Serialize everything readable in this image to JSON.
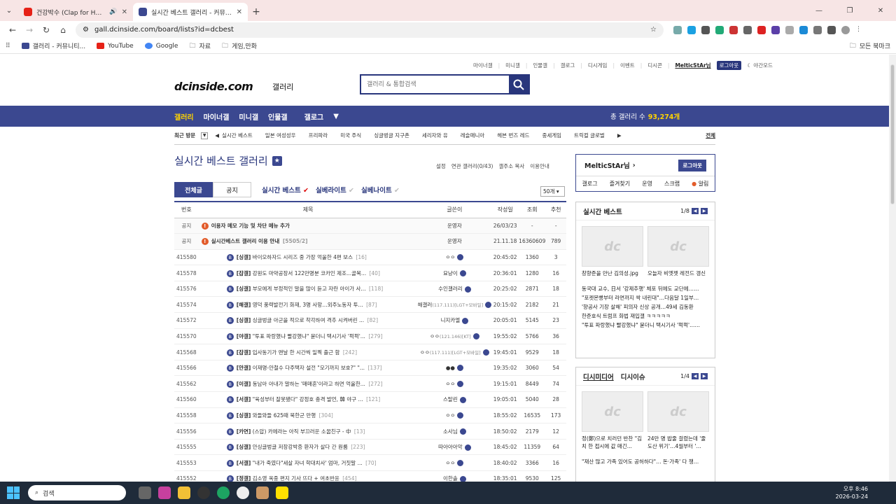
{
  "browser": {
    "tabs": [
      {
        "label": "건강박수 (Clap for Health)"
      },
      {
        "label": "실시간 베스트 갤러리 - 커뮤니티"
      }
    ],
    "url": "gall.dcinside.com/board/lists?id=dcbest",
    "bookmarks": [
      "갤러리 - 커뮤니티...",
      "YouTube",
      "Google",
      "자료",
      "게임,만화"
    ],
    "bookmarks_right": "모든 북마크"
  },
  "top_links": {
    "items": [
      "마이너갤",
      "미니갤",
      "인물갤",
      "갤로그",
      "디시게임",
      "이벤트",
      "디시콘"
    ],
    "user": "MelticStAr님",
    "logout": "로그아웃",
    "night": "야간모드"
  },
  "header": {
    "logo": "dcinside.com",
    "logo_sub": "갤러리",
    "search_placeholder": "갤러리 & 통합검색"
  },
  "gnb": {
    "items": [
      "갤러리",
      "마이너갤",
      "미니갤",
      "인물갤",
      "갤로그"
    ],
    "count_label": "총 갤러리 수",
    "count": "93,274개"
  },
  "recent": {
    "label": "최근 방문",
    "items": [
      "실시간 베스트",
      "일본 여성성우",
      "프리파라",
      "미국 주식",
      "싱글벙글 지구촌",
      "세리자와 유",
      "레슬매니아",
      "헤븐 번즈 레드",
      "중세게임",
      "트릭컬 글로벌"
    ],
    "all": "전체"
  },
  "gallery": {
    "title": "실시간 베스트 갤러리",
    "options": [
      "설정",
      "연관 갤러리(0/43)",
      "갤주소 복사",
      "이용안내"
    ]
  },
  "list_tabs": {
    "all": "전체글",
    "notice": "공지",
    "best_links": [
      "실시간 베스트",
      "실베라이트",
      "실베나이트"
    ],
    "per_page": "50개"
  },
  "table": {
    "headers": [
      "번호",
      "제목",
      "글쓴이",
      "작성일",
      "조회",
      "추천"
    ],
    "rows": [
      {
        "num": "공지",
        "title": "이용자 메모 기능 및 차단 메뉴 추가",
        "cmt": "",
        "writer": "운영자",
        "date": "26/03/23",
        "views": "-",
        "rec": "-",
        "notice": true
      },
      {
        "num": "공지",
        "title": "실시간베스트 갤러리 이용 안내",
        "cmt": "[5505/2]",
        "writer": "운영자",
        "date": "21.11.18",
        "views": "16360609",
        "rec": "789",
        "notice": true
      },
      {
        "num": "415580",
        "tag": "[싱갤]",
        "title": "바이오하자드 시리즈 중 가장 억울한 4편 보스",
        "cmt": "[16]",
        "writer": "ㅇㅇ",
        "date": "20:45:02",
        "views": "1360",
        "rec": "3"
      },
      {
        "num": "415578",
        "tag": "[잡갤]",
        "title": "강원도 마약공장서 122만명분 코카인 제조...골목...",
        "cmt": "[40]",
        "writer": "묘냥이",
        "date": "20:36:01",
        "views": "1280",
        "rec": "16"
      },
      {
        "num": "415576",
        "tag": "[싱갤]",
        "title": "부모에게 부정적인 말을 많이 듣고 자란 아이가 사...",
        "cmt": "[118]",
        "writer": "수인갤러리",
        "date": "20:25:02",
        "views": "2871",
        "rec": "18"
      },
      {
        "num": "415574",
        "tag": "[해갤]",
        "title": "영덕 풍력발전기 화재, 3명 사망…외주노동자 투...",
        "cmt": "[87]",
        "writer": "해갤러",
        "ip": "(117.111)[LGT+모바일]",
        "date": "20:15:02",
        "views": "2182",
        "rec": "21"
      },
      {
        "num": "415572",
        "tag": "[싱갤]",
        "title": "싱글벙글 아군을 적으로 착각하여 격추 시켜버린 ...",
        "cmt": "[82]",
        "writer": "니지카엘",
        "date": "20:05:01",
        "views": "5145",
        "rec": "23"
      },
      {
        "num": "415570",
        "tag": "[야갤]",
        "title": "\"투표 파랑했냐 빨강했냐\" 묻더니 택시기사 '퍽퍽'...",
        "cmt": "[279]",
        "writer": "ㅇㅇ",
        "ip": "(121.146)[KT]",
        "date": "19:55:02",
        "views": "5766",
        "rec": "36"
      },
      {
        "num": "415568",
        "tag": "[잡갤]",
        "title": "입사동기가 맨날 한 시간씩 일찍 출근 함",
        "cmt": "[242]",
        "writer": "ㅇㅇ",
        "ip": "(117.111)[LGT+모바일]",
        "date": "19:45:01",
        "views": "9529",
        "rec": "18"
      },
      {
        "num": "415566",
        "tag": "[안갤]",
        "title": "이재명-안철수 다주택자 설전 \"모기까지 보호?\" \"...",
        "cmt": "[137]",
        "writer": "●●",
        "date": "19:35:02",
        "views": "3060",
        "rec": "54"
      },
      {
        "num": "415562",
        "tag": "[이갤]",
        "title": "동남아 아내가 말하는 '매매혼'이라고 하면 억울한...",
        "cmt": "[272]",
        "writer": "ㅇㅇ",
        "date": "19:15:01",
        "views": "8449",
        "rec": "74"
      },
      {
        "num": "415560",
        "tag": "[서갤]",
        "title": "\"육성부터 잘못됐다\" 강정호 충격 발언, 韓 야구 ...",
        "cmt": "[121]",
        "writer": "스탈린",
        "date": "19:05:01",
        "views": "5040",
        "rec": "28"
      },
      {
        "num": "415558",
        "tag": "[싱갤]",
        "title": "와들와들 625때 북한군 만행",
        "cmt": "[304]",
        "writer": "ㅇㅇ",
        "date": "18:55:02",
        "views": "16535",
        "rec": "173"
      },
      {
        "num": "415556",
        "tag": "[카연]",
        "title": "(스압) 카에라는 아직 부끄러운 소꿉친구 - 中",
        "cmt": "[13]",
        "writer": "소사님",
        "date": "18:50:02",
        "views": "2179",
        "rec": "12"
      },
      {
        "num": "415555",
        "tag": "[싱갤]",
        "title": "안싱글벙글 저장강박증 환자가 살다 간 원룸",
        "cmt": "[223]",
        "writer": "따아아아악",
        "date": "18:45:02",
        "views": "11359",
        "rec": "64"
      },
      {
        "num": "415553",
        "tag": "[서갤]",
        "title": "\"내가 죽였다\"세살 자녀 학대치사' 엄마, 거짓말 ...",
        "cmt": "[70]",
        "writer": "ㅇㅇ",
        "date": "18:40:02",
        "views": "3366",
        "rec": "16"
      },
      {
        "num": "415552",
        "tag": "[정갤]",
        "title": "김소영 옥중 편지 기사 뜨다 + 여초반응",
        "cmt": "[454]",
        "writer": "이한솔",
        "date": "18:35:01",
        "views": "9530",
        "rec": "125"
      }
    ]
  },
  "side": {
    "user": "MelticStAr님",
    "logout": "로그아웃",
    "menu": [
      "갤로그",
      "즐겨찾기",
      "운영",
      "스크랩",
      "알림"
    ],
    "best": {
      "title": "실시간 베스트",
      "page": "1/8",
      "captions": [
        "창향준을 만난 김의성.jpg",
        "오늘자 비엣젯 레전드 갱신"
      ],
      "list": [
        "동국대 교수, 日서 '강제추행' 체포 뒤에도 교단에……",
        "\"포켓몬빵부터 라면까지 싹 내린대\"…다음달 1일부…",
        "'향공사 기장 살해' 피의자 신상 공개…49세 김동환",
        "한준호식 트럼프 화법 재입갤 ㅋㅋㅋㅋㅋ",
        "\"투표 파랑했냐 빨강했냐\" 묻더니 택시기사 '퍽퍽'……"
      ]
    },
    "media": {
      "title": "디시미디어",
      "title2": "디시이슈",
      "page": "1/4",
      "captions": [
        "정(鄭)으로 치러던 반찬 \"김치 한 접시에 값 매긴...",
        "24만 명 밥줄 걸렸는데 '줄도산 위기'…4월부터 '..."
      ],
      "list": [
        "\"재산 많고 가족 있어도 공허하다\"… 돈·가족' 다 챙…"
      ]
    }
  },
  "taskbar": {
    "search": "검색",
    "time": "오후 8:46",
    "date": "2026-03-24"
  }
}
